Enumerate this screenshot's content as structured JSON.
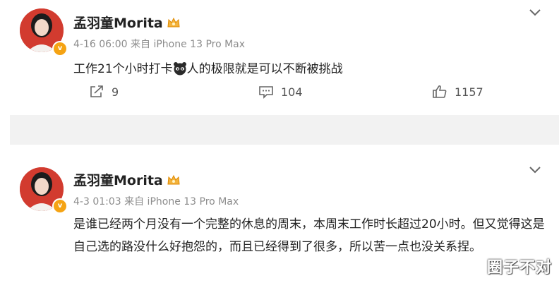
{
  "posts": [
    {
      "username": "孟羽童Morita",
      "meta": "4-16 06:00 来自 iPhone 13 Pro Max",
      "text_before_emoji": "工作21个小时打卡",
      "text_after_emoji": "人的极限就是可以不断被挑战",
      "emoji_icon": "panda-face-emoji-icon",
      "actions": {
        "repost": "9",
        "comment": "104",
        "like": "1157"
      }
    },
    {
      "username": "孟羽童Morita",
      "meta": "4-3 01:03 来自 iPhone 13 Pro Max",
      "text": "是谁已经两个月没有一个完整的休息的周末，本周末工作时长超过20小时。但又觉得这是自己选的路没什么好抱怨的，而且已经得到了很多，所以苦一点也没关系捏。"
    }
  ],
  "watermark": "圈子不对",
  "colors": {
    "verified_badge": "#f5a313",
    "meta_text": "#8c8c8c",
    "divider_gap": "#f2f2f2"
  }
}
